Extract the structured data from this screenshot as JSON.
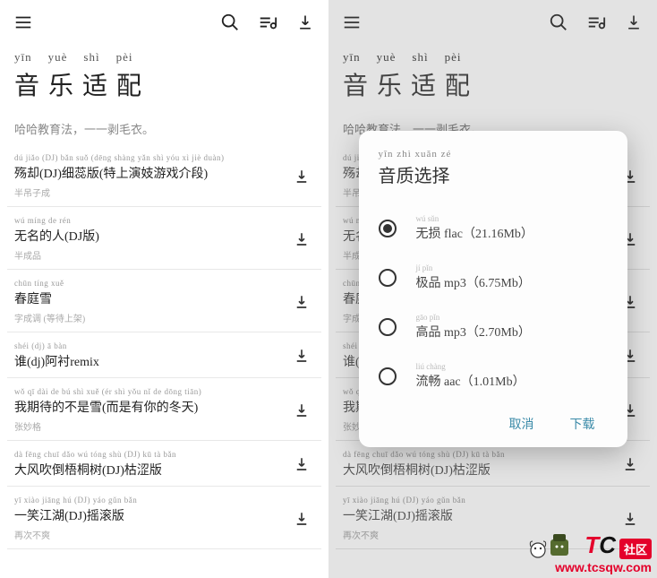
{
  "header": {
    "pinyin": [
      "yīn",
      "yuè",
      "shì",
      "pèi"
    ],
    "title": [
      "音",
      "乐",
      "适",
      "配"
    ],
    "subtitle": "哈哈教育法，一一剥毛衣。"
  },
  "songs": [
    {
      "pinyin": "dú jiǎo (DJ) bǎn suǒ (dēng shàng yǎn shì yóu xì jiè duàn)",
      "name": "殇却(DJ)细蕊版(特上演妓游戏介段)",
      "artist": "半吊子成"
    },
    {
      "pinyin": "wú míng de rén",
      "name": "无名的人(DJ版)",
      "artist": "半成品"
    },
    {
      "pinyin": "chūn tíng xuě",
      "name": "春庭雪",
      "artist": "字成调 (等待上架)"
    },
    {
      "pinyin": "shéi (dj) ā bàn",
      "name": "谁(dj)阿衬remix",
      "artist": ""
    },
    {
      "pinyin": "wǒ qī dài de bú shì xuě (ér shì yǒu nǐ de dōng tiān)",
      "name": "我期待的不是雪(而是有你的冬天)",
      "artist": "张妙格"
    },
    {
      "pinyin": "dà fēng chuī dǎo wú tóng shù (DJ) kū tà bǎn",
      "name": "大风吹倒梧桐树(DJ)枯涩版",
      "artist": ""
    },
    {
      "pinyin": "yī xiào jiāng hú (DJ) yáo gǔn bǎn",
      "name": "一笑江湖(DJ)摇滚版",
      "artist": "再次不爽"
    }
  ],
  "dialog": {
    "pinyin": "yīn zhì xuǎn zé",
    "title": "音质选择",
    "options": [
      {
        "pinyin": "wú sǔn",
        "label": "无损 flac（21.16Mb）",
        "selected": true
      },
      {
        "pinyin": "jí pǐn",
        "label": "极品 mp3（6.75Mb）",
        "selected": false
      },
      {
        "pinyin": "gāo pǐn",
        "label": "高品 mp3（2.70Mb）",
        "selected": false
      },
      {
        "pinyin": "liú chàng",
        "label": "流畅 aac（1.01Mb）",
        "selected": false
      }
    ],
    "cancel": "取消",
    "confirm": "下载"
  },
  "watermark": {
    "brand_t": "T",
    "brand_c": "C",
    "brand_suffix": "社区",
    "url": "www.tcsqw.com"
  }
}
